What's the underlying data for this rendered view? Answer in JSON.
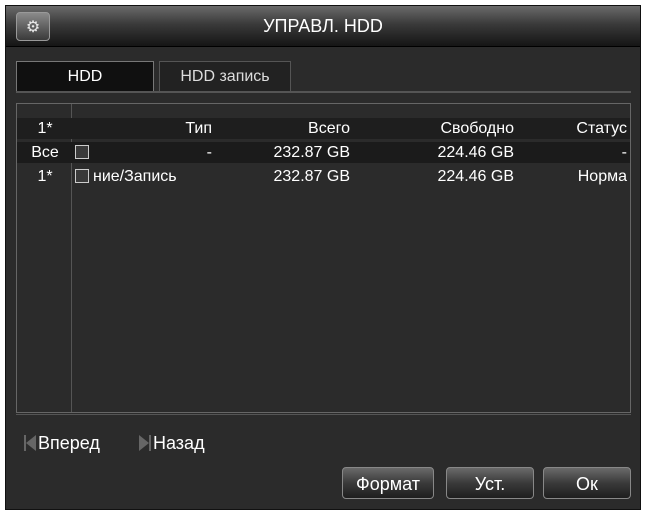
{
  "window": {
    "title": "УПРАВЛ. HDD",
    "icon": "hdd-tool-icon"
  },
  "tabs": [
    {
      "label": "HDD",
      "active": true
    },
    {
      "label": "HDD запись",
      "active": false
    }
  ],
  "table": {
    "headers": {
      "idx": "1*",
      "type": "Тип",
      "total": "Всего",
      "free": "Свободно",
      "status": "Статус"
    },
    "rows": [
      {
        "idx": "Все",
        "type": "-",
        "total": "232.87 GB",
        "free": "224.46 GB",
        "status": "-"
      },
      {
        "idx": "1*",
        "type": "ние/Запись",
        "total": "232.87 GB",
        "free": "224.46 GB",
        "status": "Норма"
      }
    ]
  },
  "nav": {
    "prev_label": "Вперед",
    "next_label": "Назад"
  },
  "buttons": {
    "format": "Формат",
    "set": "Уст.",
    "ok": "Ок"
  }
}
